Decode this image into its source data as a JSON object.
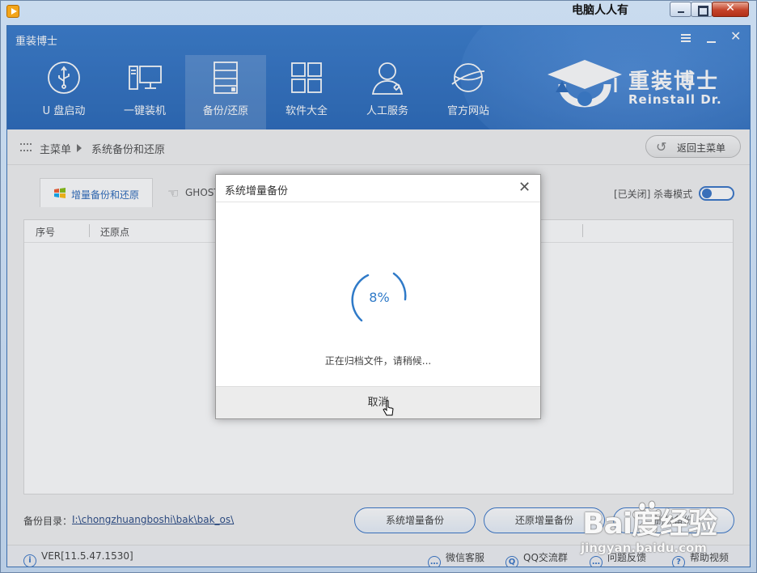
{
  "watermark_top": "电脑人人有",
  "app": {
    "title": "重装博士",
    "brand_cn": "重装博士",
    "brand_en": "Reinstall Dr."
  },
  "nav": [
    {
      "label": "U 盘启动",
      "icon": "usb-icon"
    },
    {
      "label": "一键装机",
      "icon": "computer-icon"
    },
    {
      "label": "备份/还原",
      "icon": "server-icon",
      "active": true
    },
    {
      "label": "软件大全",
      "icon": "grid-icon"
    },
    {
      "label": "人工服务",
      "icon": "person-icon"
    },
    {
      "label": "官方网站",
      "icon": "globe-icon"
    }
  ],
  "breadcrumb": {
    "main": "主菜单",
    "current": "系统备份和还原",
    "back_label": "返回主菜单"
  },
  "tabs": {
    "incremental": "增量备份和还原",
    "ghost": "GHOST"
  },
  "antivirus": {
    "label": "[已关闭] 杀毒模式"
  },
  "table": {
    "columns": [
      "序号",
      "还原点"
    ]
  },
  "backup_dir": {
    "label": "备份目录：",
    "path": "I:\\chongzhuangboshi\\bak\\bak_os\\"
  },
  "actions": {
    "incremental_backup": "系统增量备份",
    "restore_incremental": "还原增量备份",
    "more": "删除备份"
  },
  "footer": {
    "version": "VER[11.5.47.1530]",
    "wechat": "微信客服",
    "qq": "QQ交流群",
    "feedback": "问题反馈",
    "help": "帮助视频"
  },
  "dialog": {
    "title": "系统增量备份",
    "percent": "8%",
    "progress": 0.08,
    "status": "正在归档文件，请稍候...",
    "cancel": "取消"
  },
  "baidu": {
    "text": "Bai度经验",
    "url": "jingyan.baidu.com"
  },
  "colors": {
    "header": "#1f65bd",
    "accent": "#2b6cc4",
    "spinner": "#2f7ac8"
  }
}
